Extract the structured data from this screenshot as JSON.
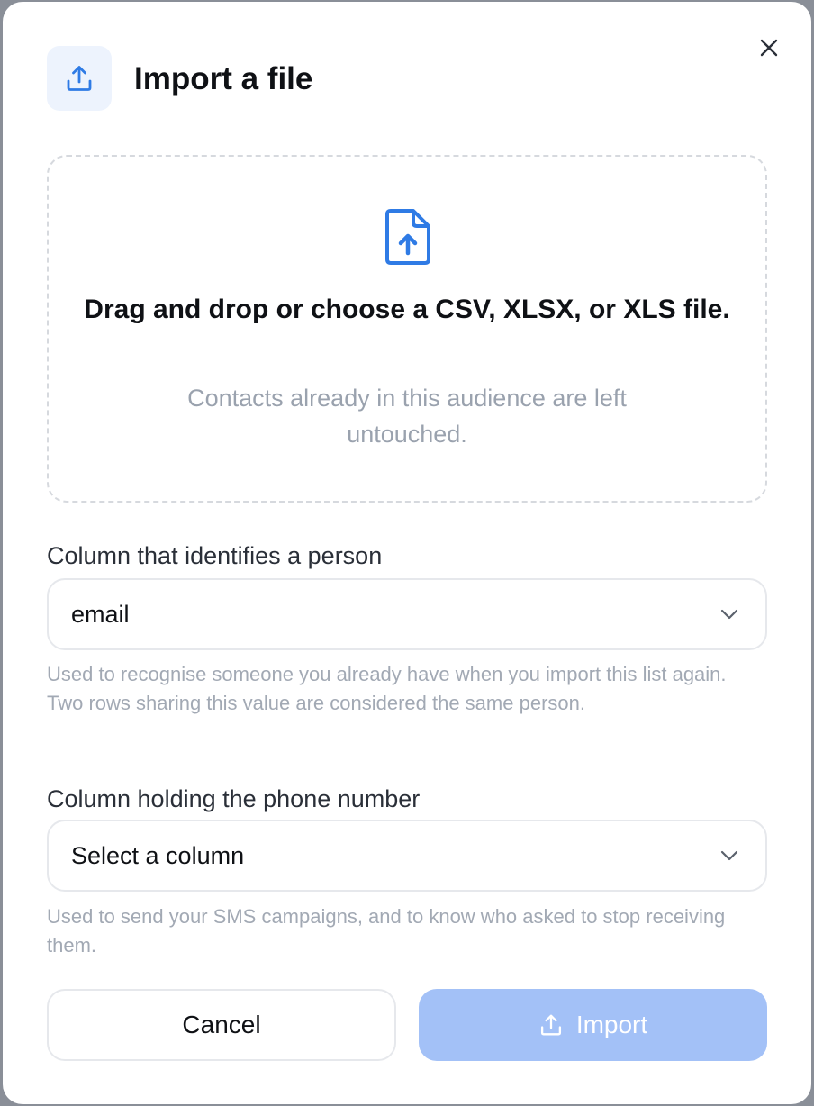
{
  "dialog": {
    "title": "Import a file",
    "header_icon": "upload-icon",
    "close_icon": "close-icon"
  },
  "dropzone": {
    "icon": "file-upload-icon",
    "main_text": "Drag and drop or choose a CSV, XLSX, or XLS file.",
    "sub_text": "Contacts already in this audience are left untouched."
  },
  "identifier_field": {
    "label": "Column that identifies a person",
    "value": "email",
    "help": "Used to recognise someone you already have when you import this list again. Two rows sharing this value are considered the same person."
  },
  "phone_field": {
    "label": "Column holding the phone number",
    "value": "Select a column",
    "help": "Used to send your SMS campaigns, and to know who asked to stop receiving them."
  },
  "actions": {
    "cancel_label": "Cancel",
    "import_label": "Import",
    "import_icon": "upload-icon",
    "import_disabled": true
  },
  "colors": {
    "accent": "#2f7be5",
    "accent_light_bg": "#edf3fd",
    "import_disabled_bg": "#a3c1f7",
    "muted_text": "#9aa2ae"
  }
}
